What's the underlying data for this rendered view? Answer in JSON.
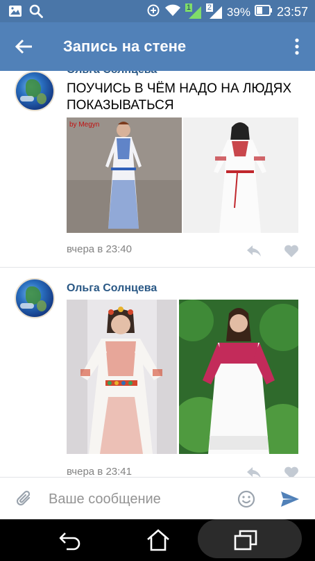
{
  "status_bar": {
    "icons": [
      "gallery-icon",
      "search-icon",
      "data-saver-icon",
      "wifi-icon",
      "signal-sim1-icon",
      "signal-sim2-icon",
      "battery-icon"
    ],
    "sim1_label": "1",
    "sim2_label": "2",
    "battery_percent": "39%",
    "time": "23:57"
  },
  "header": {
    "title": "Запись на стене"
  },
  "posts": [
    {
      "author": "Ольга Солнцева",
      "text": "ПОУЧИСЬ В ЧЁМ НАДО НА ЛЮДЯХ ПОКАЗЫВАТЬСЯ",
      "photo_watermark": "by Megyn",
      "time": "вчера в 23:40"
    },
    {
      "author": "Ольга Солнцева",
      "text": "",
      "time": "вчера в 23:41"
    }
  ],
  "composer": {
    "placeholder": "Ваше сообщение"
  },
  "colors": {
    "status_bar": "#4a76a8",
    "header": "#5181b8",
    "author_link": "#2a5885",
    "meta_gray": "#828282",
    "send_accent": "#5181b8"
  }
}
